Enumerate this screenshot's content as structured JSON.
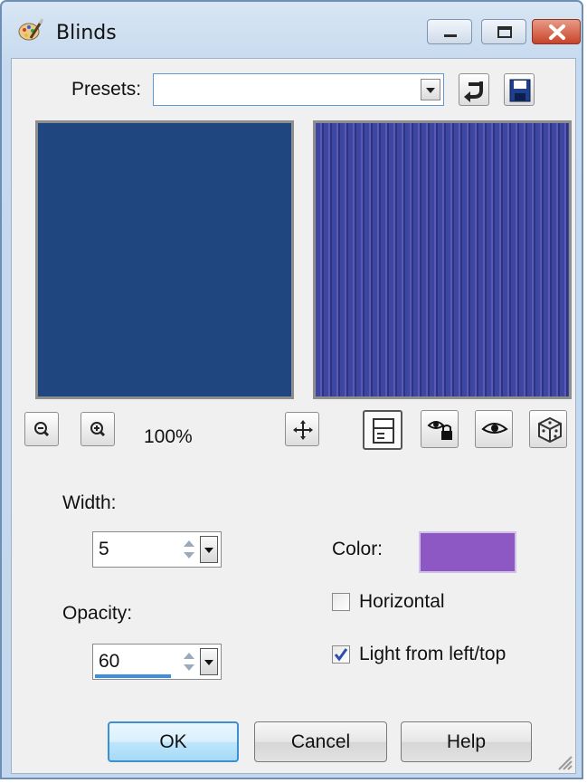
{
  "window": {
    "title": "Blinds",
    "app_icon": "palette-brush-icon",
    "caption_buttons": [
      "minimize-icon",
      "maximize-icon",
      "close-icon"
    ]
  },
  "presets": {
    "label": "Presets:",
    "value": "",
    "placeholder": "",
    "buttons": [
      "reset-arrow-icon",
      "save-disk-icon"
    ]
  },
  "preview": {
    "original_color": "#1f467e",
    "result_colors": [
      "#3d46a0",
      "#5a59b6",
      "#2c3480"
    ],
    "zoom": "100%",
    "tools": [
      "zoom-out-icon",
      "zoom-in-icon",
      "pan-move-icon",
      "toggle-preview-icon",
      "lock-eye-icon",
      "eye-icon",
      "randomize-dice-icon"
    ]
  },
  "fields": {
    "width_label": "Width:",
    "width_value": "5",
    "opacity_label": "Opacity:",
    "opacity_value": "60",
    "opacity_fraction": 0.6,
    "color_label": "Color:",
    "color_value": "#8e58c4"
  },
  "options": {
    "horizontal_label": "Horizontal",
    "horizontal_checked": false,
    "light_label": "Light from left/top",
    "light_checked": true
  },
  "buttons": {
    "ok": "OK",
    "cancel": "Cancel",
    "help": "Help"
  }
}
